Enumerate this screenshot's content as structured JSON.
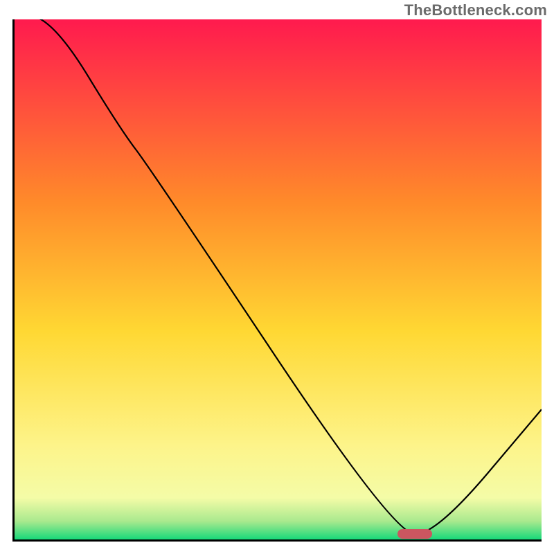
{
  "watermark": "TheBottleneck.com",
  "colors": {
    "top": "#ff1a4e",
    "mid_upper": "#ff9a2a",
    "mid": "#ffe437",
    "mid_lower": "#fff9a0",
    "bottom": "#17d87a",
    "curve": "#000000",
    "marker": "#cb5660",
    "axis": "#000000"
  },
  "chart_data": {
    "type": "line",
    "title": "",
    "xlabel": "",
    "ylabel": "",
    "xlim": [
      0,
      100
    ],
    "ylim": [
      0,
      100
    ],
    "x": [
      0,
      8,
      20,
      26,
      72,
      80,
      100
    ],
    "values": [
      102,
      99,
      79,
      71,
      1,
      1,
      25
    ],
    "annotations": [
      {
        "kind": "marker",
        "x": 76,
        "y": 1,
        "color": "#cb5660"
      }
    ],
    "background_gradient": [
      {
        "offset": 0.0,
        "color": "#ff1a4e"
      },
      {
        "offset": 0.35,
        "color": "#ff8a2a"
      },
      {
        "offset": 0.6,
        "color": "#ffd833"
      },
      {
        "offset": 0.82,
        "color": "#fdf48a"
      },
      {
        "offset": 0.92,
        "color": "#f4fca7"
      },
      {
        "offset": 0.965,
        "color": "#a9e98e"
      },
      {
        "offset": 1.0,
        "color": "#17d87a"
      }
    ]
  }
}
